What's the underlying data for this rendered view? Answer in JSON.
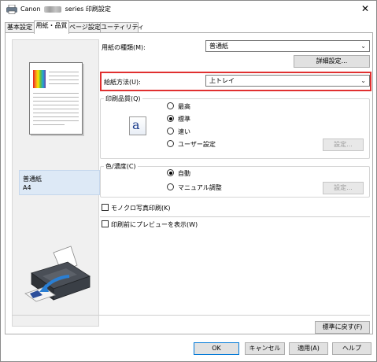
{
  "window": {
    "title_prefix": "Canon",
    "title_suffix": "series 印刷設定",
    "close_glyph": "✕"
  },
  "tabs": [
    {
      "label": "基本設定",
      "active": false
    },
    {
      "label": "用紙・品質",
      "active": true
    },
    {
      "label": "ページ設定",
      "active": false
    },
    {
      "label": "ユーティリティ",
      "active": false
    }
  ],
  "preview": {
    "media_type": "普通紙",
    "paper_size": "A4"
  },
  "paper_type": {
    "label": "用紙の種類(M):",
    "value": "普通紙",
    "details_button": "詳細設定..."
  },
  "paper_source": {
    "label": "給紙方法(U):",
    "value": "上トレイ"
  },
  "print_quality": {
    "title": "印刷品質(Q)",
    "options": [
      "最高",
      "標準",
      "速い",
      "ユーザー設定"
    ],
    "selected": "標準",
    "settings_button": "設定..."
  },
  "color_intensity": {
    "title": "色/濃度(C)",
    "options": [
      "自動",
      "マニュアル調整"
    ],
    "selected": "自動",
    "settings_button": "設定..."
  },
  "checkboxes": {
    "mono_photo": "モノクロ写真印刷(K)",
    "preview_before_print": "印刷前にプレビューを表示(W)"
  },
  "buttons": {
    "restore_defaults": "標準に戻す(F)",
    "ok": "OK",
    "cancel": "キャンセル",
    "apply": "適用(A)",
    "help": "ヘルプ"
  },
  "icons": {
    "chevron": "⌄"
  },
  "colors": {
    "highlight_border": "#e03030",
    "info_box_bg": "#dde9f6"
  }
}
